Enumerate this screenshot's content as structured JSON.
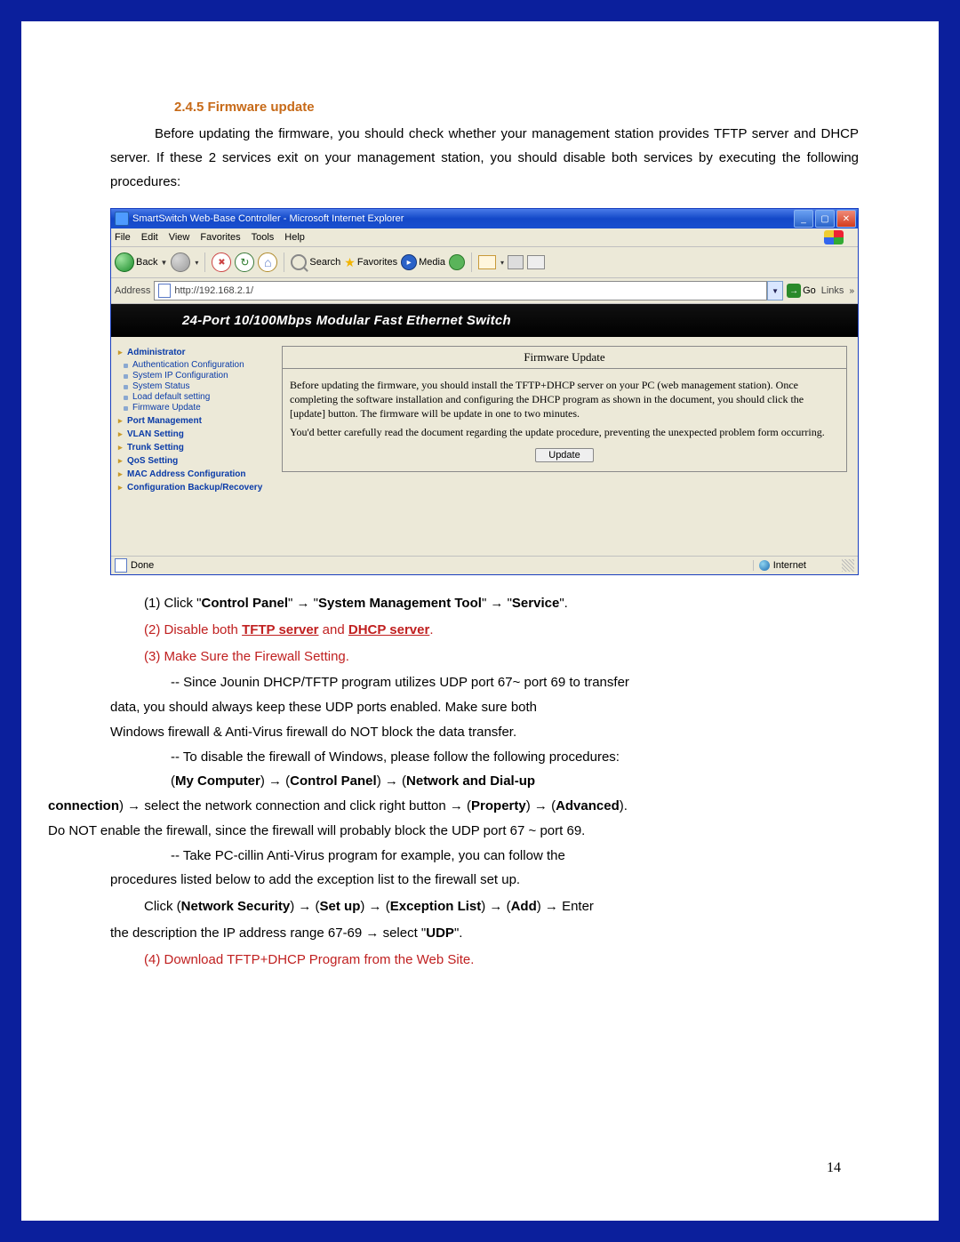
{
  "heading": "2.4.5 Firmware update",
  "intro": "Before updating the firmware, you should check whether your management station provides TFTP server and DHCP server. If these 2 services exit on your management station, you should disable both services by executing the following procedures:",
  "ie": {
    "title": "SmartSwitch Web-Base Controller - Microsoft Internet Explorer",
    "menus": [
      "File",
      "Edit",
      "View",
      "Favorites",
      "Tools",
      "Help"
    ],
    "toolbar": {
      "back": "Back",
      "search": "Search",
      "favorites": "Favorites",
      "media": "Media"
    },
    "address_label": "Address",
    "url": "http://192.168.2.1/",
    "go": "Go",
    "links": "Links",
    "status_done": "Done",
    "status_zone": "Internet"
  },
  "switch": {
    "header": "24-Port 10/100Mbps Modular Fast Ethernet Switch",
    "nav": {
      "admin": "Administrator",
      "admin_items": [
        "Authentication Configuration",
        "System IP Configuration",
        "System Status",
        "Load default setting",
        "Firmware Update"
      ],
      "cats": [
        "Port Management",
        "VLAN Setting",
        "Trunk Setting",
        "QoS Setting",
        "MAC Address Configuration",
        "Configuration Backup/Recovery"
      ]
    },
    "panel": {
      "title": "Firmware Update",
      "p1": "Before updating the firmware, you should install the TFTP+DHCP server on your PC (web management station). Once completing the software installation and configuring the DHCP program as shown in the document, you should click the [update] button. The firmware will be update in one to two minutes.",
      "p2": "You'd better carefully read the document regarding the update procedure, preventing the unexpected problem form occurring.",
      "button": "Update"
    }
  },
  "steps": {
    "s1_pre": "(1) Click \"",
    "s1_a": "Control Panel",
    "s1_mid1": "\" → \"",
    "s1_b": "System Management Tool",
    "s1_mid2": "\" → \"",
    "s1_c": "Service",
    "s1_end": "\".",
    "s2_pre": "(2) Disable both ",
    "s2_a": "TFTP server",
    "s2_mid": " and ",
    "s2_b": "DHCP server",
    "s2_end": ".",
    "s3": "(3) Make Sure the Firewall Setting.",
    "s3a": "-- Since Jounin DHCP/TFTP program utilizes UDP port 67~ port 69 to transfer",
    "s3a2": "data, you should always keep these UDP ports enabled. Make sure both",
    "s3a3": "Windows firewall & Anti-Virus firewall do NOT block the data transfer.",
    "s3b": "-- To disable the firewall of Windows, please follow the following procedures:",
    "s3c_pre": "(",
    "s3c_a": "My Computer",
    "s3c_m1": ") → (",
    "s3c_b": "Control Panel",
    "s3c_m2": ") → (",
    "s3c_c": "Network and Dial-up",
    "s3d_pre": "connection",
    "s3d_m1": ") → select the network connection and click right button → (",
    "s3d_a": "Property",
    "s3d_m2": ") → (",
    "s3d_b": "Advanced",
    "s3d_end": ").",
    "s3e": "Do NOT enable the firewall, since the firewall will probably block the UDP port 67 ~ port 69.",
    "s3f": "-- Take PC-cillin Anti-Virus program for example, you can follow the",
    "s3f2": "procedures listed below to add the exception list to the firewall set up.",
    "s3g_pre": "Click (",
    "s3g_a": "Network Security",
    "s3g_m1": ") → (",
    "s3g_b": "Set up",
    "s3g_m2": ") → (",
    "s3g_c": "Exception List",
    "s3g_m3": ") → (",
    "s3g_d": "Add",
    "s3g_m4": ") → Enter",
    "s3h_pre": "the description the IP address range 67-69 → select \"",
    "s3h_a": "UDP",
    "s3h_end": "\".",
    "s4": "(4) Download TFTP+DHCP Program from the Web Site."
  },
  "page_number": "14"
}
